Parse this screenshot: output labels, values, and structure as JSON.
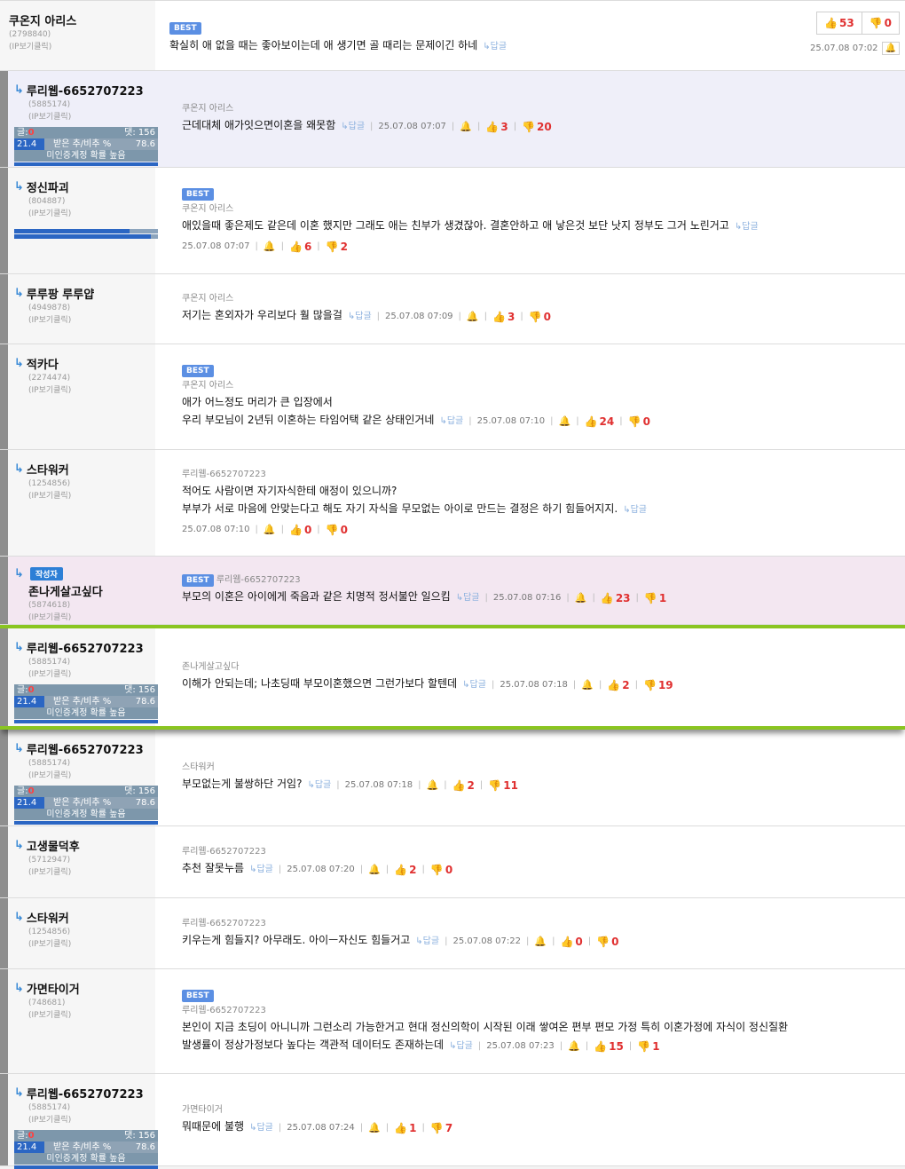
{
  "labels": {
    "ip_click": "(IP보기클릭)",
    "reply": "↳답글",
    "best": "BEST",
    "author_badge": "작성자",
    "stat_posts_label": "글:",
    "stat_posts_value": "0",
    "stat_comments": "댓: 156",
    "stat_ratio_left": "21.4",
    "stat_ratio_label": "받은 추/비추 %",
    "stat_ratio_right": "78.6",
    "stat_warning": "미인증계정 확률 높음"
  },
  "icons": {
    "reply": "reply-arrow-icon",
    "up": "thumbs-up-icon",
    "down": "thumbs-down-icon",
    "bell": "bell-icon"
  },
  "colors": {
    "accent": "#2b66c3",
    "best": "#5b8fe3",
    "vote_count": "#e03030",
    "highlight_border": "#8ac521"
  },
  "top": {
    "nick": "쿠온지 아리스",
    "uid": "(2798840)",
    "text": "확실히 애 없을 때는 좋아보이는데 애 생기면 골 때리는 문제이긴 하네",
    "up": "53",
    "down": "0",
    "date": "25.07.08 07:02"
  },
  "comments": [
    {
      "nick": "루리웹-6652707223",
      "uid": "(5885174)",
      "stats": true,
      "target": "쿠온지 아리스",
      "lines": [
        "근데대체 애가잇으면이혼을 왜못함"
      ],
      "date": "25.07.08 07:07",
      "up": "3",
      "down": "20"
    },
    {
      "nick": "정신파괴",
      "uid": "(804887)",
      "bars": [
        0.8,
        0.95
      ],
      "best": true,
      "target": "쿠온지 아리스",
      "lines": [
        "애있을때 좋은제도 같은데 이혼 했지만 그래도 애는 친부가 생겼잖아. 결혼안하고 애 낳은것 보단 낫지 정부도 그거 노린거고"
      ],
      "date": "25.07.08 07:07",
      "up": "6",
      "down": "2"
    },
    {
      "nick": "루루팡 루루얍",
      "uid": "(4949878)",
      "target": "쿠온지 아리스",
      "lines": [
        "저기는 혼외자가 우리보다 훨 많을걸"
      ],
      "date": "25.07.08 07:09",
      "up": "3",
      "down": "0"
    },
    {
      "nick": "적카다",
      "uid": "(2274474)",
      "best": true,
      "target": "쿠온지 아리스",
      "lines": [
        "애가 어느정도 머리가 큰 입장에서",
        "우리 부모님이 2년뒤 이혼하는 타임어택 같은 상태인거네"
      ],
      "date": "25.07.08 07:10",
      "up": "24",
      "down": "0"
    },
    {
      "nick": "스타워커",
      "uid": "(1254856)",
      "target": "루리웹-6652707223",
      "lines": [
        "적어도 사람이면 자기자식한테 애정이 있으니까?",
        "부부가 서로 마음에 안맞는다고 해도 자기 자식을 무모없는 아이로 만드는 결정은 하기 힘들어지지."
      ],
      "date": "25.07.08 07:10",
      "up": "0",
      "down": "0"
    },
    {
      "nick": "존나게살고싶다",
      "uid": "(5874618)",
      "author": true,
      "best": true,
      "target": "루리웹-6652707223",
      "hl": "pink",
      "lines": [
        "부모의 이혼은 아이에게 죽음과 같은 치명적 정서불안 일으킴"
      ],
      "date": "25.07.08 07:16",
      "up": "23",
      "down": "1"
    },
    {
      "nick": "루리웹-6652707223",
      "uid": "(5885174)",
      "stats": true,
      "target": "존나게살고싶다",
      "hl": "green",
      "lines": [
        "이해가 안되는데; 나초딩때 부모이혼했으면 그런가보다 할텐데"
      ],
      "date": "25.07.08 07:18",
      "up": "2",
      "down": "19"
    },
    {
      "nick": "루리웹-6652707223",
      "uid": "(5885174)",
      "stats": true,
      "target": "스타워커",
      "lines": [
        "부모없는게 불쌍하단 거임?"
      ],
      "date": "25.07.08 07:18",
      "up": "2",
      "down": "11"
    },
    {
      "nick": "고생물덕후",
      "uid": "(5712947)",
      "target": "루리웹-6652707223",
      "lines": [
        "추천 잘못누름"
      ],
      "date": "25.07.08 07:20",
      "up": "2",
      "down": "0"
    },
    {
      "nick": "스타워커",
      "uid": "(1254856)",
      "target": "루리웹-6652707223",
      "lines": [
        "키우는게 힘들지? 아무래도. 아이ㅡ자신도 힘들거고"
      ],
      "date": "25.07.08 07:22",
      "up": "0",
      "down": "0"
    },
    {
      "nick": "가면타이거",
      "uid": "(748681)",
      "best": true,
      "target": "루리웹-6652707223",
      "lines": [
        "본인이 지금 초딩이 아니니까 그런소리 가능한거고 현대 정신의학이 시작된 이래 쌓여온 편부 편모 가정 특히 이혼가정에 자식이 정신질환",
        "발생률이 정상가정보다 높다는 객관적 데이터도 존재하는데"
      ],
      "date": "25.07.08 07:23",
      "up": "15",
      "down": "1"
    },
    {
      "nick": "루리웹-6652707223",
      "uid": "(5885174)",
      "stats": true,
      "target": "가면타이거",
      "lines": [
        "뭐때문에 불행"
      ],
      "date": "25.07.08 07:24",
      "up": "1",
      "down": "7"
    }
  ]
}
